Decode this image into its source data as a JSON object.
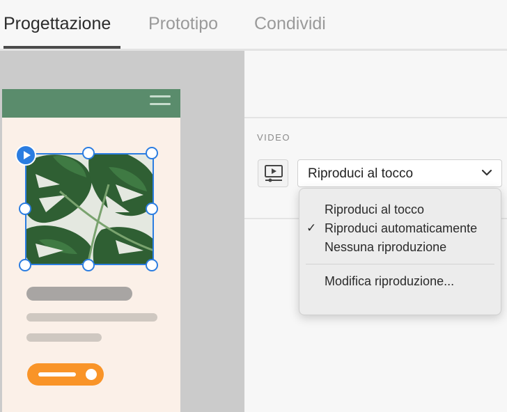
{
  "tabs": [
    {
      "label": "Progettazione",
      "active": true
    },
    {
      "label": "Prototipo",
      "active": false
    },
    {
      "label": "Condividi",
      "active": false
    }
  ],
  "panel": {
    "section_label": "VIDEO",
    "video_icon": "video-playback-icon",
    "dropdown": {
      "selected": "Riproduci al tocco",
      "chevron_icon": "chevron-down-icon"
    },
    "menu": {
      "items": [
        {
          "label": "Riproduci al tocco",
          "checked": false
        },
        {
          "label": "Riproduci automaticamente",
          "checked": true
        },
        {
          "label": "Nessuna riproduzione",
          "checked": false
        }
      ],
      "footer_item": "Modifica riproduzione...",
      "check_mark": "✓"
    }
  },
  "canvas": {
    "header_color": "#5a8c6c",
    "selection_color": "#2b7de1",
    "button_color": "#f99428",
    "artboard_background": "#fbf0e8",
    "icons": [
      "hamburger-menu-icon",
      "play-icon"
    ]
  }
}
